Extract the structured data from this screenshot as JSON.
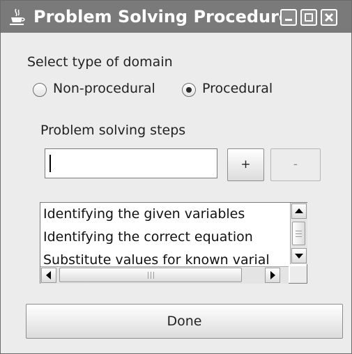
{
  "window": {
    "title": "Problem Solving Procedure",
    "colors": {
      "titlebar": "#7a7a7a",
      "body": "#ececec"
    },
    "icons": [
      "java-cup-icon",
      "minimize-icon",
      "maximize-icon",
      "close-icon"
    ]
  },
  "domain": {
    "label": "Select type of domain",
    "options": [
      {
        "label": "Non-procedural",
        "selected": false
      },
      {
        "label": "Procedural",
        "selected": true
      }
    ]
  },
  "steps": {
    "label": "Problem solving steps",
    "input_value": "",
    "add_label": "+",
    "remove_label": "-",
    "items": [
      "Identifying the given variables",
      "Identifying the correct equation",
      "Substitute values for known varial"
    ]
  },
  "done_label": "Done"
}
